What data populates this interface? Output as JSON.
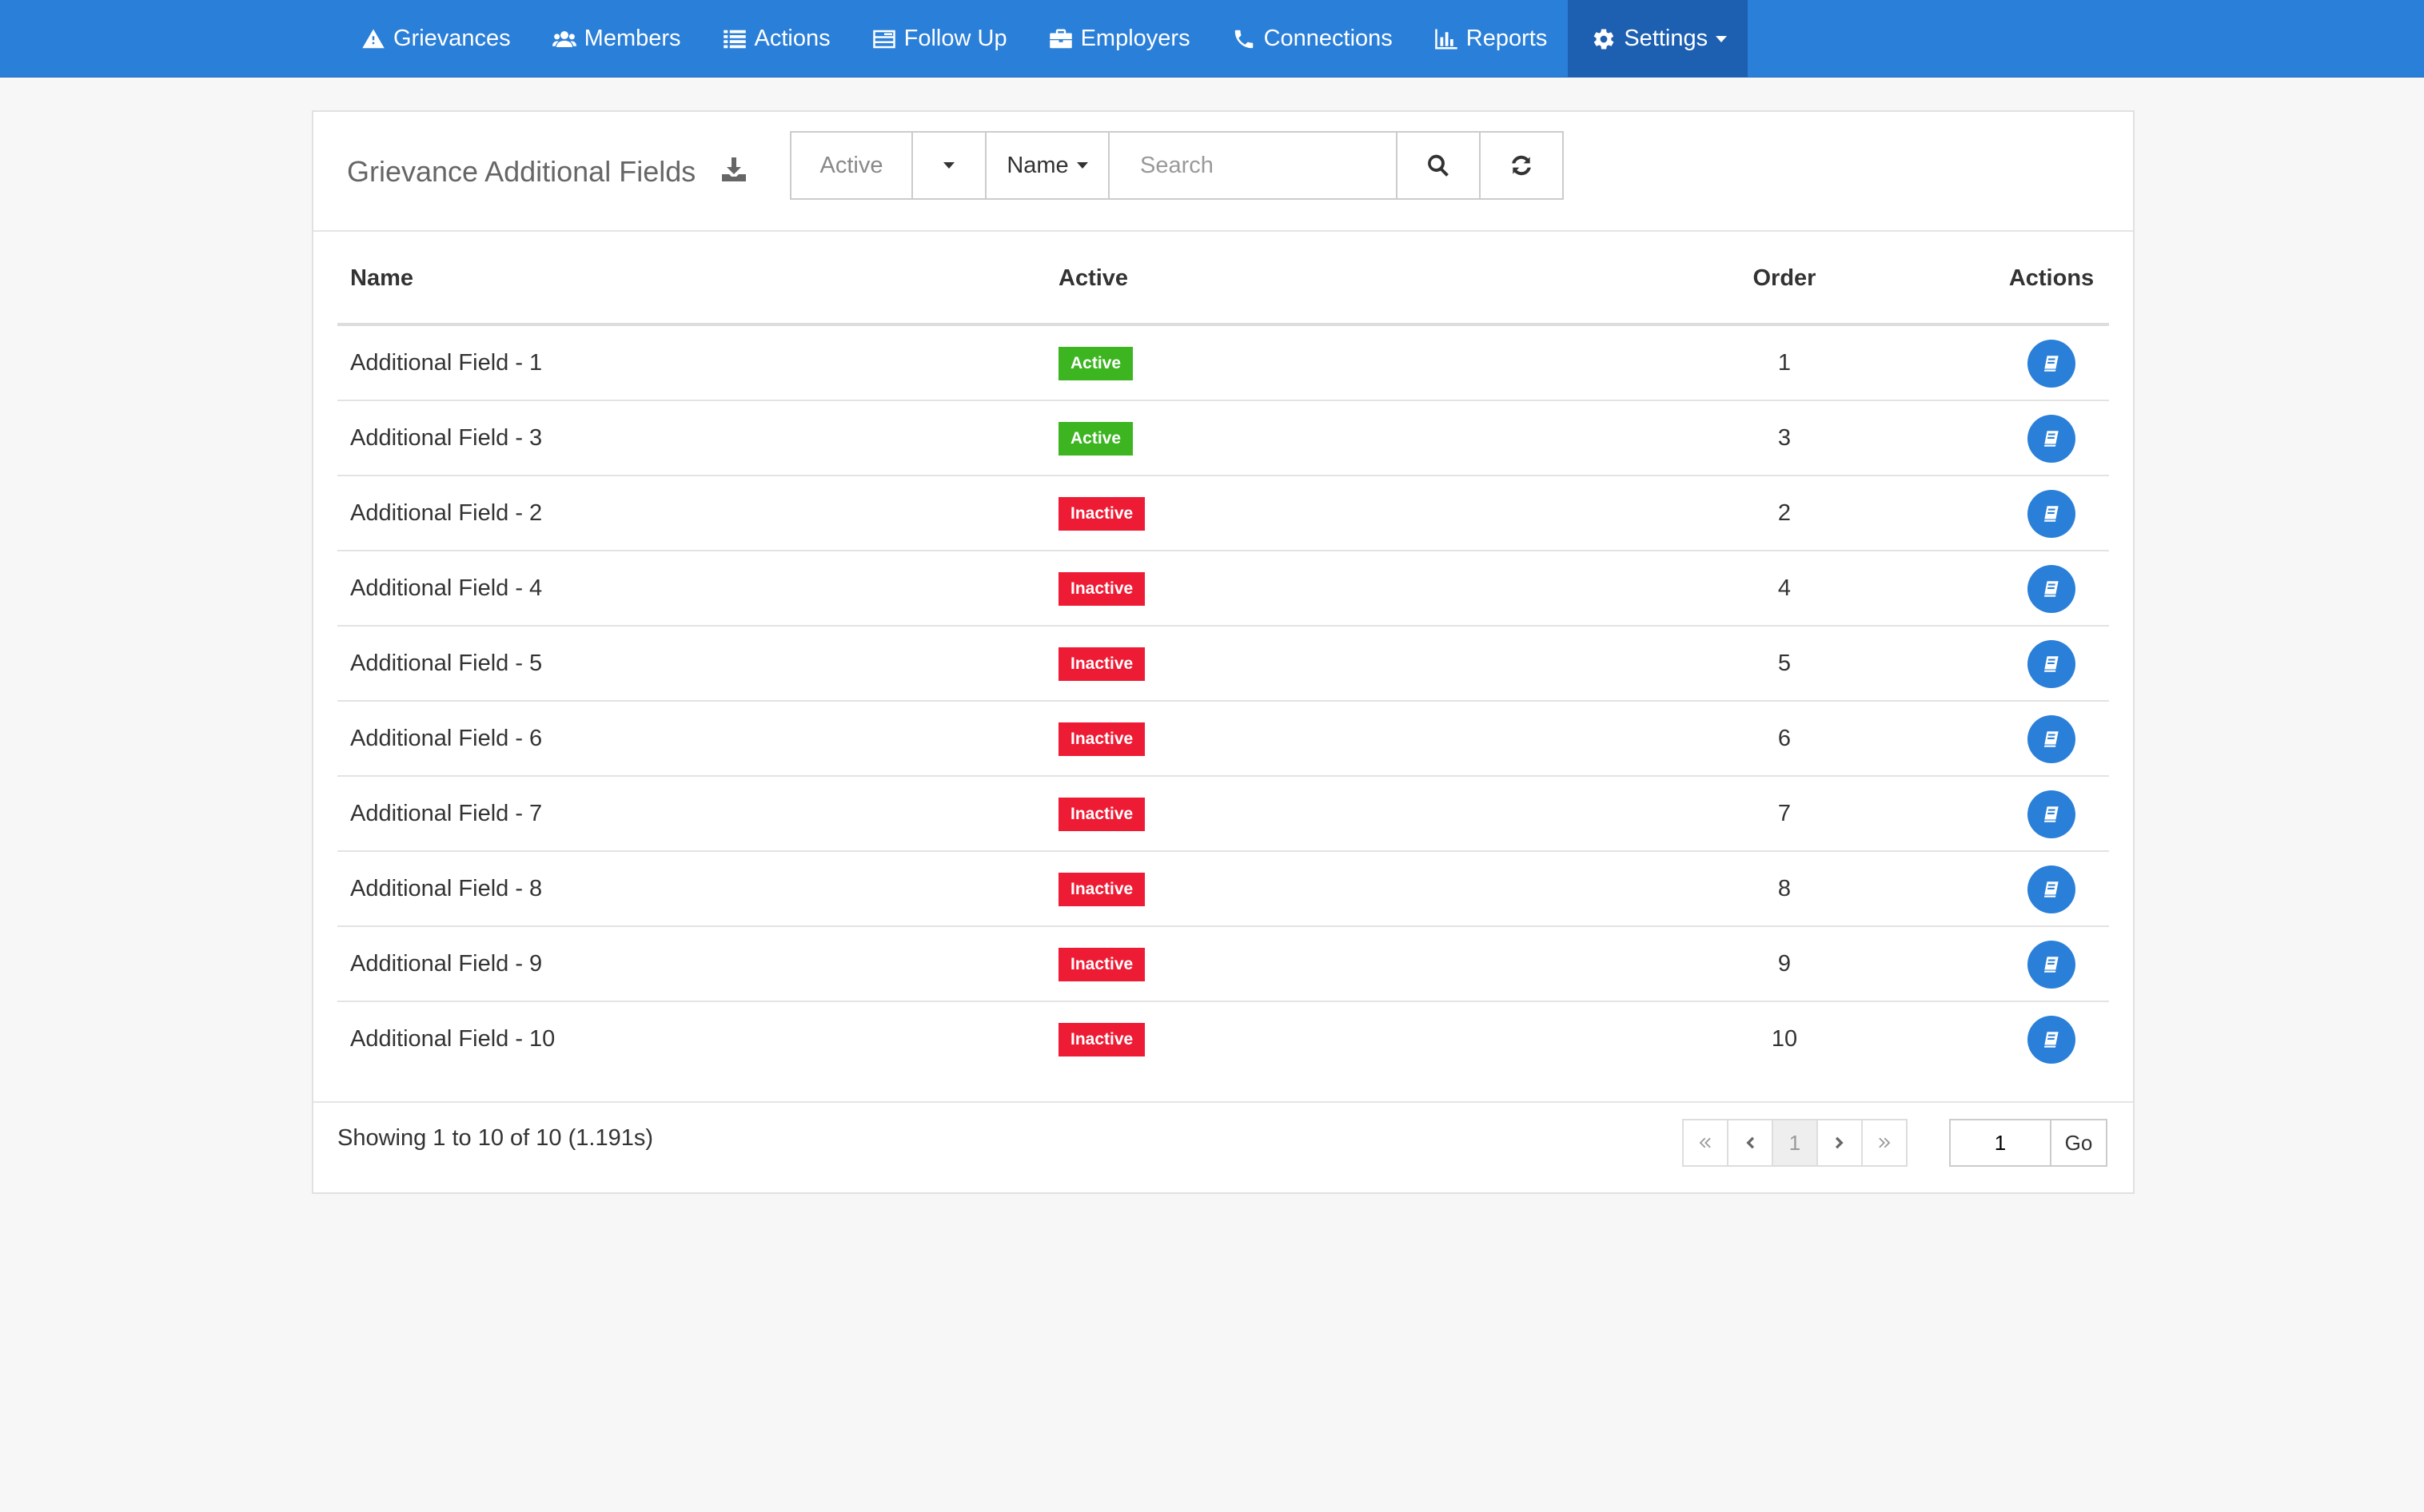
{
  "nav": {
    "items": [
      {
        "label": "Grievances",
        "icon": "warning-icon"
      },
      {
        "label": "Members",
        "icon": "users-icon"
      },
      {
        "label": "Actions",
        "icon": "list-icon"
      },
      {
        "label": "Follow Up",
        "icon": "tasks-icon"
      },
      {
        "label": "Employers",
        "icon": "briefcase-icon"
      },
      {
        "label": "Connections",
        "icon": "phone-icon"
      },
      {
        "label": "Reports",
        "icon": "bar-chart-icon"
      },
      {
        "label": "Settings",
        "icon": "gear-icon",
        "active": true
      }
    ],
    "color": "#2a7fd9",
    "active_color": "#1d5fb0"
  },
  "panel": {
    "title": "Grievance Additional Fields",
    "filter": {
      "status_value": "Active",
      "field_value": "Name",
      "search_placeholder": "Search"
    }
  },
  "table": {
    "headers": {
      "name": "Name",
      "active": "Active",
      "order": "Order",
      "actions": "Actions"
    },
    "rows": [
      {
        "name": "Additional Field - 1",
        "status": "Active",
        "order": "1"
      },
      {
        "name": "Additional Field - 3",
        "status": "Active",
        "order": "3"
      },
      {
        "name": "Additional Field - 2",
        "status": "Inactive",
        "order": "2"
      },
      {
        "name": "Additional Field - 4",
        "status": "Inactive",
        "order": "4"
      },
      {
        "name": "Additional Field - 5",
        "status": "Inactive",
        "order": "5"
      },
      {
        "name": "Additional Field - 6",
        "status": "Inactive",
        "order": "6"
      },
      {
        "name": "Additional Field - 7",
        "status": "Inactive",
        "order": "7"
      },
      {
        "name": "Additional Field - 8",
        "status": "Inactive",
        "order": "8"
      },
      {
        "name": "Additional Field - 9",
        "status": "Inactive",
        "order": "9"
      },
      {
        "name": "Additional Field - 10",
        "status": "Inactive",
        "order": "10"
      }
    ],
    "status_colors": {
      "Active": "#3cb521",
      "Inactive": "#ee1b34"
    }
  },
  "footer": {
    "showing": "Showing 1 to 10 of 10 (1.191s)",
    "current_page": "1",
    "goto_value": "1",
    "go_label": "Go"
  }
}
